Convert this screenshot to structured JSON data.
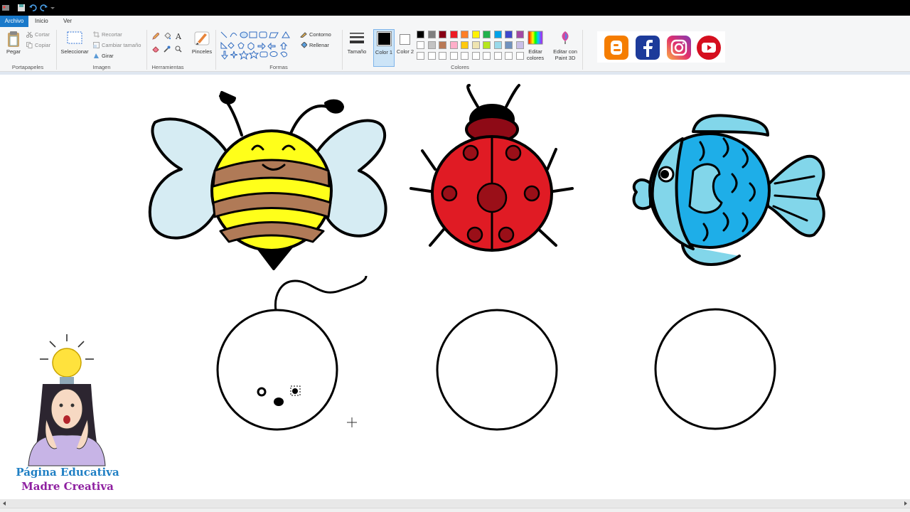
{
  "tabs": {
    "file": "Archivo",
    "home": "Inicio",
    "view": "Ver"
  },
  "clipboard": {
    "paste": "Pegar",
    "cut": "Cortar",
    "copy": "Copiar",
    "group": "Portapapeles"
  },
  "image": {
    "select": "Seleccionar",
    "crop": "Recortar",
    "resize": "Cambiar tamaño",
    "rotate": "Girar",
    "group": "Imagen"
  },
  "tools": {
    "group": "Herramientas",
    "brushes": "Pinceles"
  },
  "shapes": {
    "outline": "Contorno",
    "fill": "Rellenar",
    "group": "Formas"
  },
  "size": {
    "label": "Tamaño"
  },
  "colors": {
    "color1": "Color 1",
    "color2": "Color 2",
    "group": "Colores",
    "edit": "Editar colores",
    "paint3d": "Editar con Paint 3D",
    "palette_row1": [
      "#000000",
      "#7f7f7f",
      "#880015",
      "#ed1c24",
      "#ff7f27",
      "#fff200",
      "#22b14c",
      "#00a2e8",
      "#3f48cc",
      "#a349a4"
    ],
    "palette_row2": [
      "#ffffff",
      "#c3c3c3",
      "#b97a57",
      "#ffaec9",
      "#ffc90e",
      "#efe4b0",
      "#b5e61d",
      "#99d9ea",
      "#7092be",
      "#c8bfe7"
    ],
    "palette_row3": [
      "#ffffff",
      "#ffffff",
      "#ffffff",
      "#ffffff",
      "#ffffff",
      "#ffffff",
      "#ffffff",
      "#ffffff",
      "#ffffff",
      "#ffffff"
    ],
    "accent_selected": "#cce4f7"
  },
  "social": [
    "blogger-icon",
    "facebook-icon",
    "instagram-icon",
    "youtube-icon"
  ],
  "brand": {
    "line1": "Página Educativa",
    "line2": "Madre Creativa",
    "color1": "#1f7fc4",
    "color2": "#8e1fa0"
  }
}
